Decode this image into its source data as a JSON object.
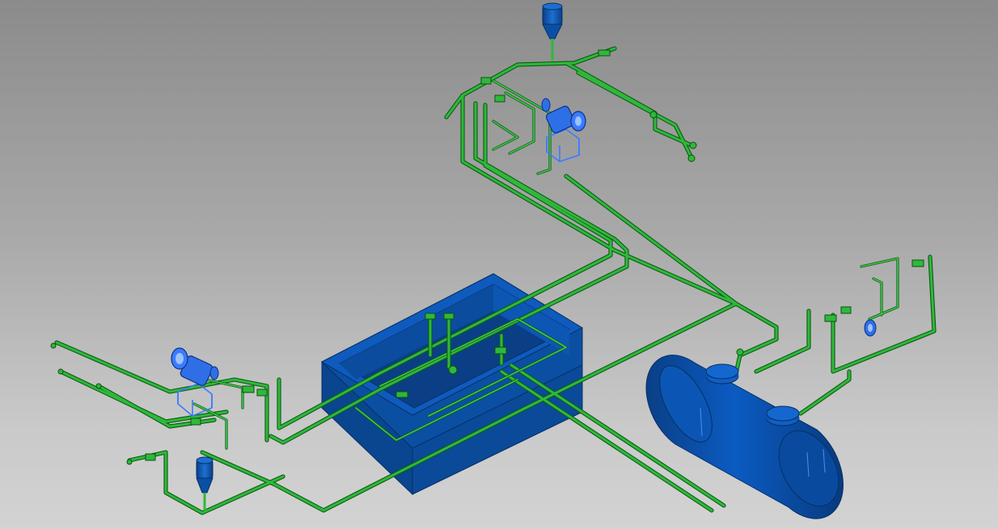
{
  "colors": {
    "background_top": "#8b8b8b",
    "background_bottom": "#d3d3d3",
    "pipe": "#2fb83b",
    "pipe_dark": "#0f5a16",
    "tank_front": "#0b4fa3",
    "tank_side": "#0a3f86",
    "tank_top": "#0e5bbd",
    "pump": "#3a7bff",
    "vessel": "#0b56b4"
  },
  "icons": {
    "pump_top": "centrifugal-pump-icon",
    "pump_left": "centrifugal-pump-icon",
    "valve": "valve-icon",
    "hopper": "silo-hopper-icon",
    "horizontal_vessel": "horizontal-tank-icon",
    "open_tank": "open-rectangular-tank-icon"
  }
}
